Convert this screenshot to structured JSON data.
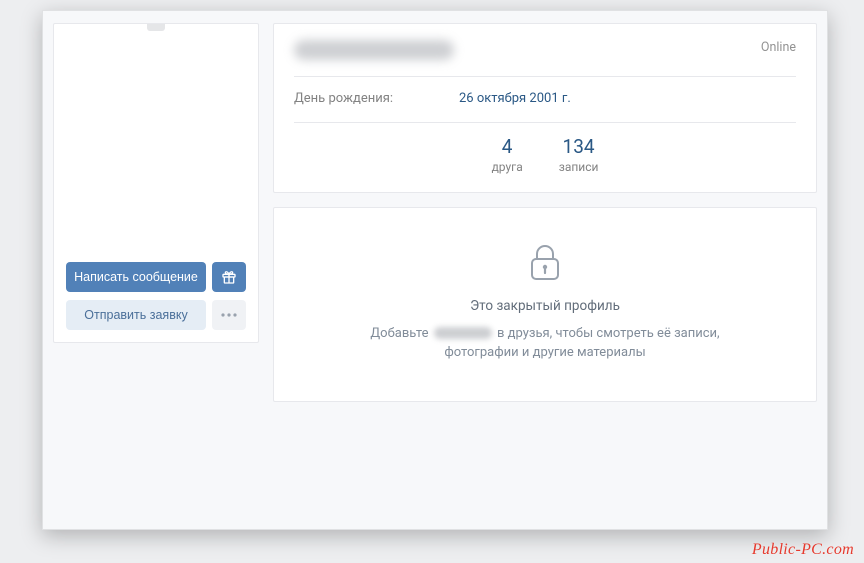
{
  "sidebar": {
    "message_button": "Написать сообщение",
    "request_button": "Отправить заявку"
  },
  "profile": {
    "status": "Online",
    "birthday_label": "День рождения:",
    "birthday_value": "26 октября 2001 г.",
    "stats": [
      {
        "count": "4",
        "label": "друга"
      },
      {
        "count": "134",
        "label": "записи"
      }
    ]
  },
  "private": {
    "title": "Это закрытый профиль",
    "desc_before": "Добавьте",
    "desc_after": "в друзья, чтобы смотреть её записи, фотографии и другие материалы"
  },
  "watermark": "Public-PC.com"
}
